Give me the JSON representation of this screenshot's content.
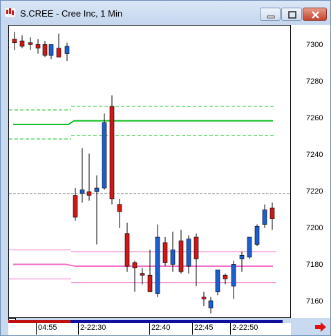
{
  "window": {
    "title": "S.CREE - Cree Inc, 1 Min"
  },
  "price_axis": {
    "labels": [
      "7300",
      "7280",
      "7260",
      "7240",
      "7220",
      "7200",
      "7180",
      "7160"
    ]
  },
  "time_axis": {
    "labels": [
      "04:55",
      "2-22:30",
      "22:40",
      "22:45",
      "2-22:50"
    ]
  },
  "colors": {
    "up": "#1a5fd0",
    "down": "#d01818",
    "green": "#10c020",
    "pink": "#f070c8",
    "gray": "#808080"
  },
  "chart_data": {
    "type": "candlestick",
    "ylim": [
      7150,
      7310
    ],
    "y_ticks": [
      7300,
      7280,
      7260,
      7240,
      7220,
      7200,
      7180,
      7160
    ],
    "candles": [
      {
        "o": 7304,
        "h": 7308,
        "l": 7298,
        "c": 7302
      },
      {
        "o": 7303,
        "h": 7306,
        "l": 7299,
        "c": 7300
      },
      {
        "o": 7302,
        "h": 7305,
        "l": 7298,
        "c": 7301
      },
      {
        "o": 7301,
        "h": 7304,
        "l": 7296,
        "c": 7299
      },
      {
        "o": 7301,
        "h": 7303,
        "l": 7294,
        "c": 7295
      },
      {
        "o": 7295,
        "h": 7300,
        "l": 7293,
        "c": 7301
      },
      {
        "o": 7299,
        "h": 7307,
        "l": 7294,
        "c": 7294
      },
      {
        "o": 7296,
        "h": 7302,
        "l": 7292,
        "c": 7300
      },
      {
        "o": 7218,
        "h": 7222,
        "l": 7204,
        "c": 7206
      },
      {
        "o": 7219,
        "h": 7244,
        "l": 7214,
        "c": 7221
      },
      {
        "o": 7220,
        "h": 7241,
        "l": 7215,
        "c": 7218
      },
      {
        "o": 7220,
        "h": 7229,
        "l": 7191,
        "c": 7222
      },
      {
        "o": 7222,
        "h": 7263,
        "l": 7221,
        "c": 7258
      },
      {
        "o": 7267,
        "h": 7273,
        "l": 7213,
        "c": 7216
      },
      {
        "o": 7213,
        "h": 7216,
        "l": 7200,
        "c": 7209
      },
      {
        "o": 7197,
        "h": 7203,
        "l": 7176,
        "c": 7179
      },
      {
        "o": 7181,
        "h": 7182,
        "l": 7165,
        "c": 7178
      },
      {
        "o": 7175,
        "h": 7178,
        "l": 7169,
        "c": 7174
      },
      {
        "o": 7174,
        "h": 7188,
        "l": 7167,
        "c": 7165
      },
      {
        "o": 7164,
        "h": 7202,
        "l": 7162,
        "c": 7195
      },
      {
        "o": 7192,
        "h": 7195,
        "l": 7179,
        "c": 7181
      },
      {
        "o": 7180,
        "h": 7198,
        "l": 7176,
        "c": 7188
      },
      {
        "o": 7193,
        "h": 7199,
        "l": 7175,
        "c": 7176
      },
      {
        "o": 7179,
        "h": 7196,
        "l": 7175,
        "c": 7194
      },
      {
        "o": 7195,
        "h": 7197,
        "l": 7168,
        "c": 7183
      },
      {
        "o": 7162,
        "h": 7165,
        "l": 7157,
        "c": 7161
      },
      {
        "o": 7156,
        "h": 7162,
        "l": 7153,
        "c": 7160
      },
      {
        "o": 7165,
        "h": 7176,
        "l": 7163,
        "c": 7177
      },
      {
        "o": 7174,
        "h": 7175,
        "l": 7169,
        "c": 7172
      },
      {
        "o": 7168,
        "h": 7182,
        "l": 7161,
        "c": 7180
      },
      {
        "o": 7183,
        "h": 7187,
        "l": 7176,
        "c": 7185
      },
      {
        "o": 7184,
        "h": 7195,
        "l": 7183,
        "c": 7195
      },
      {
        "o": 7191,
        "h": 7202,
        "l": 7190,
        "c": 7201
      },
      {
        "o": 7202,
        "h": 7213,
        "l": 7200,
        "c": 7210
      },
      {
        "o": 7211,
        "h": 7214,
        "l": 7199,
        "c": 7205
      }
    ],
    "levels": {
      "green_upper": [
        7265,
        7267
      ],
      "green_mid": [
        7257,
        7259
      ],
      "green_lower": [
        7249,
        7251
      ],
      "pink_upper": [
        7188,
        7187
      ],
      "pink_mid": [
        7180,
        7179
      ],
      "pink_lower": [
        7172,
        7170
      ],
      "gray": 7219
    }
  }
}
